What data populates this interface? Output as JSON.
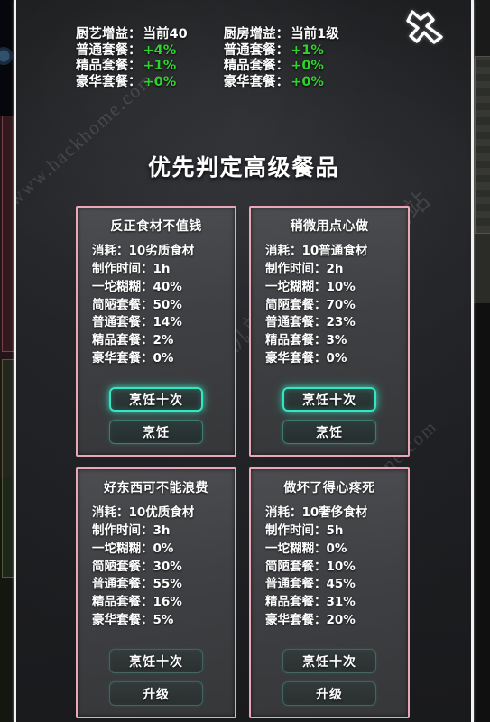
{
  "window": {
    "close_icon": "close-x-icon"
  },
  "watermarks": {
    "latin_1": "www.hackhome.com",
    "latin_2": "www.hackhome.com",
    "cn_1": "游客手机站",
    "cn_2": "游客手机站"
  },
  "buffs": [
    {
      "id": "cooking-skill-buff",
      "title_label": "厨艺增益：",
      "title_value": "当前40",
      "rows": [
        {
          "label": "普通套餐：",
          "value": "+4%",
          "color": "#2fd22f"
        },
        {
          "label": "精品套餐：",
          "value": "+1%",
          "color": "#2fd22f"
        },
        {
          "label": "豪华套餐：",
          "value": "+0%",
          "color": "#2fd22f"
        }
      ]
    },
    {
      "id": "kitchen-buff",
      "title_label": "厨房增益：",
      "title_value": "当前1级",
      "rows": [
        {
          "label": "普通套餐：",
          "value": "+1%",
          "color": "#2fd22f"
        },
        {
          "label": "精品套餐：",
          "value": "+0%",
          "color": "#2fd22f"
        },
        {
          "label": "豪华套餐：",
          "value": "+0%",
          "color": "#2fd22f"
        }
      ]
    }
  ],
  "section": {
    "title": "优先判定高级餐品"
  },
  "recipes": [
    {
      "id": "recipe-cheap-ingredients",
      "title": "反正食材不值钱",
      "stats": [
        "消耗：10劣质食材",
        "制作时间：1h",
        "一坨糊糊：40%",
        "简陋套餐：50%",
        "普通套餐：14%",
        "精品套餐：2%",
        "豪华套餐：0%"
      ],
      "buttons": [
        {
          "label": "烹饪十次",
          "style": "bright"
        },
        {
          "label": "烹饪",
          "style": "soft"
        }
      ]
    },
    {
      "id": "recipe-a-bit-of-effort",
      "title": "稍微用点心做",
      "stats": [
        "消耗：10普通食材",
        "制作时间：2h",
        "一坨糊糊：10%",
        "简陋套餐：70%",
        "普通套餐：23%",
        "精品套餐：3%",
        "豪华套餐：0%"
      ],
      "buttons": [
        {
          "label": "烹饪十次",
          "style": "bright"
        },
        {
          "label": "烹饪",
          "style": "soft"
        }
      ]
    },
    {
      "id": "recipe-dont-waste-good-stuff",
      "title": "好东西可不能浪费",
      "stats": [
        "消耗：10优质食材",
        "制作时间：3h",
        "一坨糊糊：0%",
        "简陋套餐：30%",
        "普通套餐：55%",
        "精品套餐：16%",
        "豪华套餐：5%"
      ],
      "buttons": [
        {
          "label": "烹饪十次",
          "style": "dim"
        },
        {
          "label": "升级",
          "style": "dim"
        }
      ]
    },
    {
      "id": "recipe-heartbreak-if-ruined",
      "title": "做坏了得心疼死",
      "stats": [
        "消耗：10奢侈食材",
        "制作时间：5h",
        "一坨糊糊：0%",
        "简陋套餐：10%",
        "普通套餐：45%",
        "精品套餐：31%",
        "豪华套餐：20%"
      ],
      "buttons": [
        {
          "label": "烹饪十次",
          "style": "dim"
        },
        {
          "label": "升级",
          "style": "dim"
        }
      ]
    }
  ],
  "colors": {
    "card_border": "#eaa7b8",
    "buff_positive": "#2fd22f",
    "button_glow": "#35e6c2",
    "panel_bg": "#242528"
  }
}
